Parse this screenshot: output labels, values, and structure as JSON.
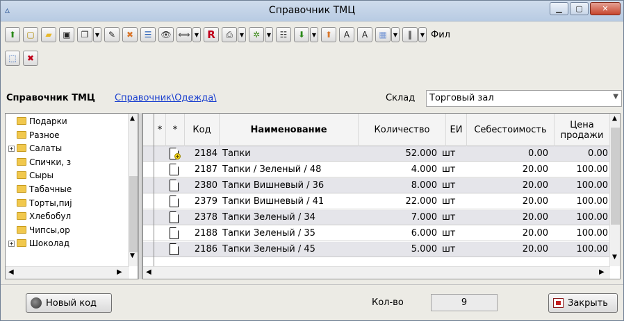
{
  "window": {
    "title": "Справочник ТМЦ"
  },
  "toolbar": {
    "row1": [
      {
        "icon": "up-arrow-icon",
        "glyph": "⬆",
        "color": "#2c8a1a",
        "dropdown": false
      },
      {
        "icon": "new-folder-icon",
        "glyph": "▢",
        "color": "#b08a00",
        "dropdown": false
      },
      {
        "icon": "folder-icon",
        "glyph": "▰",
        "color": "#e8b82a",
        "dropdown": false
      },
      {
        "icon": "save-icon",
        "glyph": "▣",
        "color": "#222",
        "dropdown": false
      },
      {
        "icon": "copy-icon",
        "glyph": "❐",
        "color": "#222",
        "dropdown": true
      },
      {
        "icon": "edit-icon",
        "glyph": "✎",
        "color": "#222",
        "dropdown": false
      },
      {
        "icon": "delete-icon",
        "glyph": "✖",
        "color": "#d9762a",
        "dropdown": false
      },
      {
        "icon": "list-view-icon",
        "glyph": "☰",
        "color": "#2b62b8",
        "dropdown": false
      },
      {
        "icon": "binoculars-icon",
        "glyph": "👁",
        "color": "#333",
        "dropdown": false
      },
      {
        "icon": "filter-icon",
        "glyph": "⟺",
        "color": "#333",
        "dropdown": true
      },
      {
        "icon": "r-icon",
        "glyph": "R",
        "color": "#c0001a",
        "dropdown": false
      },
      {
        "icon": "print-icon",
        "glyph": "⎙",
        "color": "#333",
        "dropdown": true
      },
      {
        "icon": "puzzle-icon",
        "glyph": "✲",
        "color": "#3e8a1a",
        "dropdown": true
      },
      {
        "icon": "tree-view-icon",
        "glyph": "☷",
        "color": "#333",
        "dropdown": false
      },
      {
        "icon": "import-icon",
        "glyph": "⬇",
        "color": "#2c8a1a",
        "dropdown": true
      },
      {
        "icon": "export-icon",
        "glyph": "⬆",
        "color": "#d9762a",
        "dropdown": false
      },
      {
        "icon": "font-decrease-icon",
        "glyph": "A",
        "color": "#222",
        "dropdown": false
      },
      {
        "icon": "font-increase-icon",
        "glyph": "A",
        "color": "#222",
        "dropdown": false
      },
      {
        "icon": "table-icon",
        "glyph": "▦",
        "color": "#7a9ad6",
        "dropdown": true
      },
      {
        "icon": "barcode-icon",
        "glyph": "‖",
        "color": "#000",
        "dropdown": true
      }
    ],
    "filter_label": "Фил",
    "row2": [
      {
        "icon": "grid-select-icon",
        "glyph": "⬚",
        "color": "#2b62b8"
      },
      {
        "icon": "stop-icon",
        "glyph": "✖",
        "color": "#c0001a"
      }
    ]
  },
  "breadcrumb": {
    "title": "Справочник ТМЦ",
    "path": "Справочник\\Одежда\\"
  },
  "store": {
    "label": "Склад",
    "value": "Торговый зал"
  },
  "tree": {
    "items": [
      {
        "label": "Подарки",
        "expandable": false
      },
      {
        "label": "Разное",
        "expandable": false
      },
      {
        "label": "Салаты",
        "expandable": true
      },
      {
        "label": "Спички, з",
        "expandable": false
      },
      {
        "label": "Сыры",
        "expandable": false
      },
      {
        "label": "Табачные",
        "expandable": false
      },
      {
        "label": "Торты,пиј",
        "expandable": false
      },
      {
        "label": "Хлебобул",
        "expandable": false
      },
      {
        "label": "Чипсы,ор",
        "expandable": false
      },
      {
        "label": "Шоколад",
        "expandable": true
      }
    ]
  },
  "grid": {
    "columns": {
      "star1": "*",
      "star2": "*",
      "code": "Код",
      "name": "Наименование",
      "qty": "Количество",
      "unit": "ЕИ",
      "cost": "Себестоимость",
      "price": "Цена продажи"
    },
    "rows": [
      {
        "new": true,
        "code": "2184",
        "name": "Тапки",
        "qty": "52.000",
        "unit": "шт",
        "cost": "0.00",
        "price": "0.00"
      },
      {
        "new": false,
        "code": "2187",
        "name": "Тапки  / Зеленый / 48",
        "qty": "4.000",
        "unit": "шт",
        "cost": "20.00",
        "price": "100.00"
      },
      {
        "new": false,
        "code": "2380",
        "name": "Тапки Вишневый / 36",
        "qty": "8.000",
        "unit": "шт",
        "cost": "20.00",
        "price": "100.00"
      },
      {
        "new": false,
        "code": "2379",
        "name": "Тапки Вишневый / 41",
        "qty": "22.000",
        "unit": "шт",
        "cost": "20.00",
        "price": "100.00"
      },
      {
        "new": false,
        "code": "2378",
        "name": "Тапки Зеленый / 34",
        "qty": "7.000",
        "unit": "шт",
        "cost": "20.00",
        "price": "100.00"
      },
      {
        "new": false,
        "code": "2188",
        "name": "Тапки Зеленый / 35",
        "qty": "6.000",
        "unit": "шт",
        "cost": "20.00",
        "price": "100.00"
      },
      {
        "new": false,
        "code": "2186",
        "name": "Тапки Зеленый / 45",
        "qty": "5.000",
        "unit": "шт",
        "cost": "20.00",
        "price": "100.00"
      }
    ]
  },
  "footer": {
    "new_code_label": "Новый код",
    "count_label": "Кол-во",
    "count_value": "9",
    "close_label": "Закрыть"
  }
}
